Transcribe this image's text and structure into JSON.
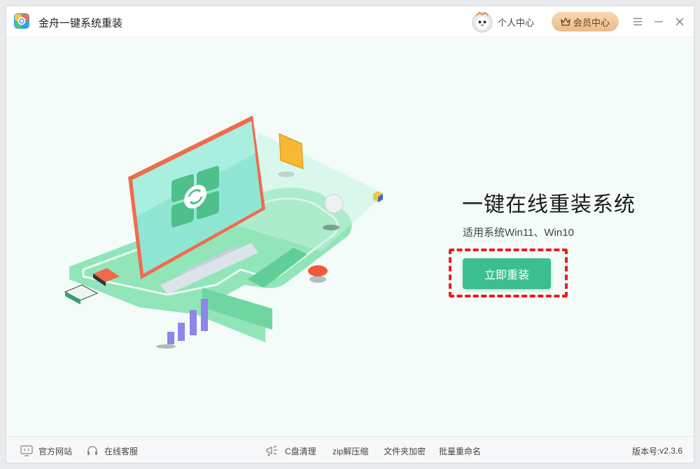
{
  "app": {
    "title": "金舟一键系统重装",
    "logo_icon": "app-logo-icon",
    "accent": "#3cbf8f"
  },
  "header": {
    "user_center_label": "个人中心",
    "vip_label": "会员中心",
    "menu_icon": "menu-icon",
    "minimize_icon": "minimize-icon",
    "close_icon": "close-icon"
  },
  "main": {
    "title": "一键在线重装系统",
    "subtitle": "适用系统Win11、Win10",
    "reinstall_label": "立即重装",
    "highlight_color": "#ee1c1c"
  },
  "footer": {
    "links": [
      {
        "label": "官方网站",
        "icon": "monitor-icon"
      },
      {
        "label": "在线客服",
        "icon": "headset-icon"
      },
      {
        "label": "C盘清理",
        "icon": "broom-icon"
      },
      {
        "label": "zip解压缩"
      },
      {
        "label": "文件夹加密"
      },
      {
        "label": "批量重命名"
      }
    ],
    "version_label": "版本号:",
    "version": "v2.3.6"
  }
}
